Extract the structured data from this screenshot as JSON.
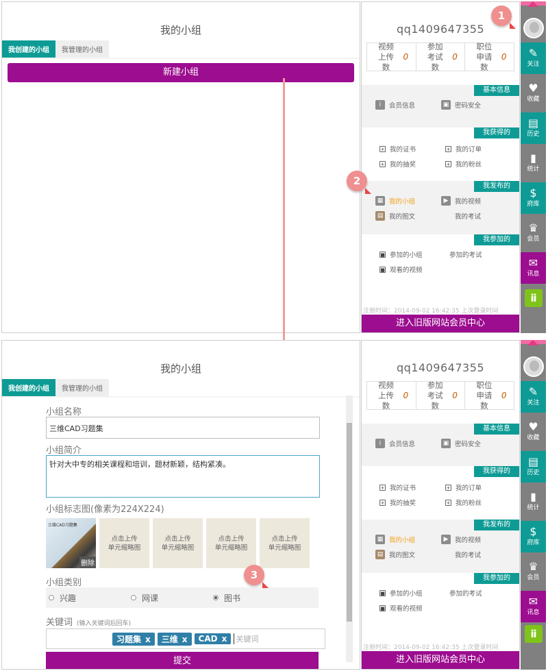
{
  "left": {
    "title": "我的小组",
    "tabs": [
      "我创建的小组",
      "我管理的小组"
    ],
    "new_group_label": "新建小组"
  },
  "right": {
    "username": "qq1409647355",
    "stats": [
      {
        "label": "视频上传数",
        "value": "0"
      },
      {
        "label": "参加考试数",
        "value": "0"
      },
      {
        "label": "职位申请数",
        "value": "0"
      }
    ],
    "sections": {
      "basic": {
        "title": "基本信息",
        "items": [
          "会员信息",
          "密码安全"
        ]
      },
      "obtained": {
        "title": "我获得的",
        "items": [
          "我的证书",
          "我的订单",
          "我的抽奖",
          "我的粉丝"
        ]
      },
      "published": {
        "title": "我发布的",
        "items": [
          "我的小组",
          "我的视频",
          "我的图文",
          "我的考试"
        ]
      },
      "joined": {
        "title": "我参加的",
        "items": [
          "参加的小组",
          "参加的考试",
          "观看的视频"
        ]
      }
    },
    "footer_partial": "注册时间：2014-09-02 16:42:35    上次登录时间",
    "old_center_label": "进入旧版网站会员中心"
  },
  "side_nav": {
    "items": [
      "关注",
      "收藏",
      "历史",
      "统计",
      "府库",
      "会员",
      "讯息"
    ]
  },
  "markers": [
    "1",
    "2",
    "3"
  ],
  "form": {
    "name_label": "小组名称",
    "name_value": "三维CAD习题集",
    "intro_label": "小组简介",
    "intro_value": "针对大中专的相关课程和培训，题材新颖，结构紧凑。",
    "logo_label": "小组标志图(像素为224X224)",
    "thumb_caption": "三维CAD习题集",
    "delete_label": "删除",
    "upload_slots": [
      "点击上传\n单元缩略图",
      "点击上传\n单元缩略图",
      "点击上传\n单元缩略图",
      "点击上传\n单元缩略图"
    ],
    "category_label": "小组类别",
    "categories": [
      "兴趣",
      "网课",
      "图书"
    ],
    "selected_category": "图书",
    "keyword_label": "关键词",
    "keyword_hint": "(输入关键词后回车)",
    "keywords": [
      "习题集",
      "三维",
      "CAD"
    ],
    "keyword_placeholder": "关键词",
    "submit_label": "提交"
  },
  "colors": {
    "teal": "#0e9b95",
    "purple": "#9c0d8f",
    "marker": "#f08f8f"
  }
}
